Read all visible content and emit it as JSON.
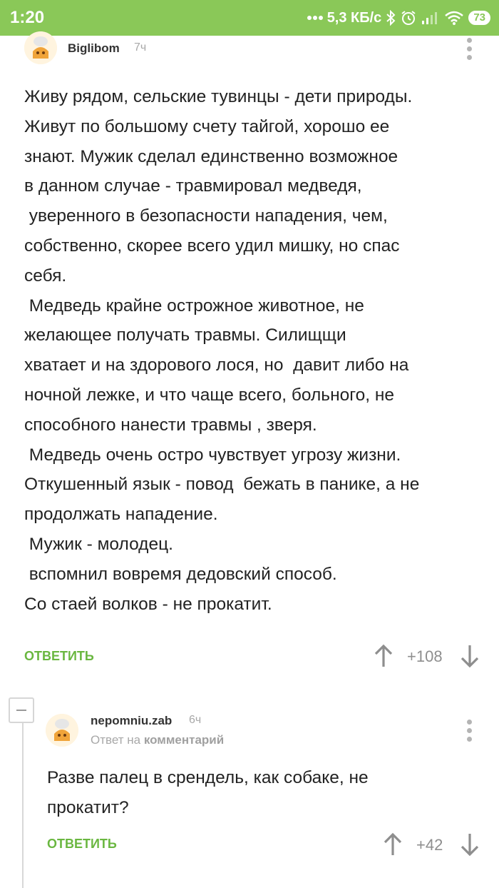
{
  "status_bar": {
    "time": "1:20",
    "network_speed": "5,3 КБ/с",
    "battery": "73",
    "accent_color": "#8ac858"
  },
  "comments": [
    {
      "username": "Biglibom",
      "time_ago": "7ч",
      "lines": [
        "Живу рядом, сельские тувинцы - дети природы.",
        "Живут по большому счету тайгой, хорошо ее",
        "знают. Мужик сделал единственно возможное",
        "в данном случае - травмировал медведя,",
        " уверенного в безопасности нападения, чем,",
        "собственно, скорее всего удил мишку, но спас",
        "себя.",
        " Медведь крайне острожное животное, не",
        "желающее получать травмы. Силищщи",
        "хватает и на здорового лося, но  давит либо на",
        "ночной лежке, и что чаще всего, больного, не",
        "способного нанести травмы , зверя.",
        " Медведь очень остро чувствует угрозу жизни.",
        "Откушенный язык - повод  бежать в панике, а не",
        "продолжать нападение.",
        " Мужик - молодец.",
        " вспомнил вовремя дедовский способ.",
        "Со стаей волков - не прокатит."
      ],
      "reply_label": "ОТВЕТИТЬ",
      "rating": "+108"
    },
    {
      "username": "nepomniu.zab",
      "time_ago": "6ч",
      "reply_to_prefix": "Ответ на",
      "reply_to_target": "комментарий",
      "lines": [
        "Разве палец в срендель, как собаке, не",
        "прокатит?"
      ],
      "reply_label": "ОТВЕТИТЬ",
      "rating": "+42"
    }
  ],
  "icons": [
    "signal-dots-icon",
    "bluetooth-icon",
    "alarm-icon",
    "cell-signal-icon",
    "wifi-icon",
    "battery-icon",
    "avatar-chef-icon",
    "more-vert-icon",
    "arrow-up-icon",
    "arrow-down-icon",
    "collapse-icon"
  ]
}
